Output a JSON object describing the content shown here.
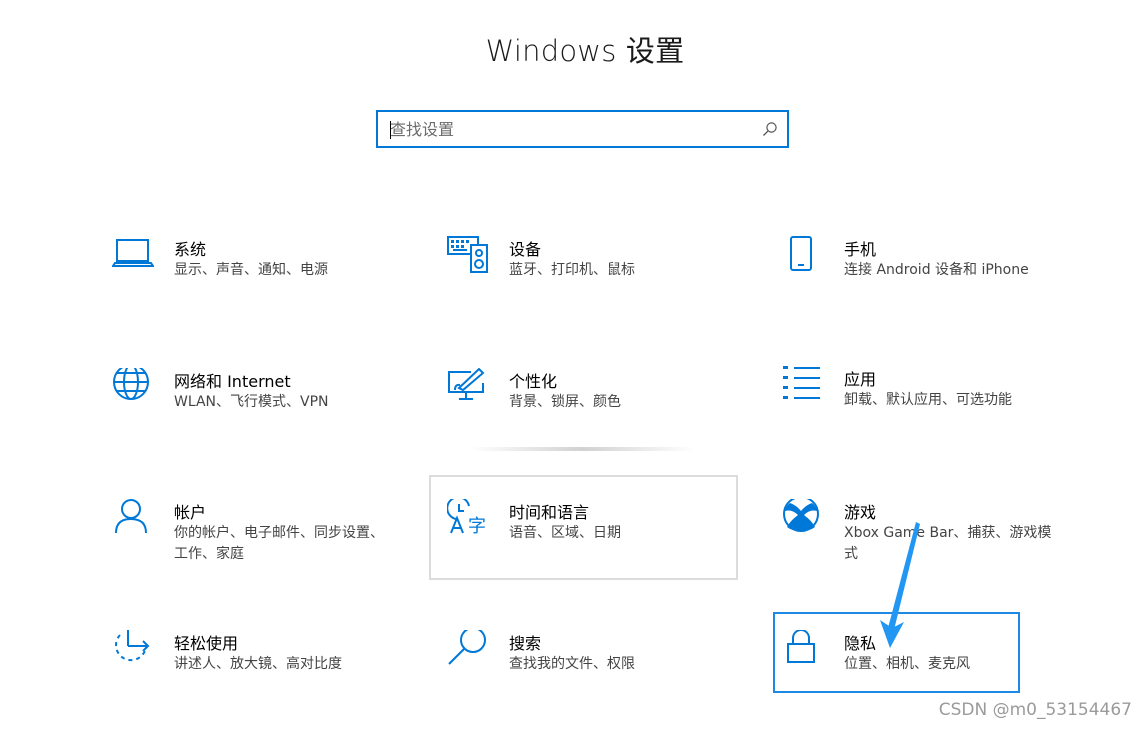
{
  "window": {
    "title": "Windows 设置"
  },
  "search": {
    "placeholder": "查找设置",
    "icon": "search-icon"
  },
  "colors": {
    "accent": "#0078d7",
    "focus_border": "#1e88e5",
    "arrow": "#2196f3"
  },
  "tiles": [
    {
      "id": "system",
      "name": "系统",
      "desc": "显示、声音、通知、电源",
      "icon": "laptop-icon"
    },
    {
      "id": "devices",
      "name": "设备",
      "desc": "蓝牙、打印机、鼠标",
      "icon": "keyboard-speaker-icon"
    },
    {
      "id": "phone",
      "name": "手机",
      "desc": "连接 Android 设备和 iPhone",
      "icon": "phone-icon"
    },
    {
      "id": "network",
      "name": "网络和 Internet",
      "desc": "WLAN、飞行模式、VPN",
      "icon": "globe-icon"
    },
    {
      "id": "personalization",
      "name": "个性化",
      "desc": "背景、锁屏、颜色",
      "icon": "paint-monitor-icon"
    },
    {
      "id": "apps",
      "name": "应用",
      "desc": "卸载、默认应用、可选功能",
      "icon": "app-list-icon"
    },
    {
      "id": "accounts",
      "name": "帐户",
      "desc": "你的帐户、电子邮件、同步设置、工作、家庭",
      "icon": "person-icon"
    },
    {
      "id": "time-language",
      "name": "时间和语言",
      "desc": "语音、区域、日期",
      "icon": "clock-language-icon"
    },
    {
      "id": "gaming",
      "name": "游戏",
      "desc": "Xbox Game Bar、捕获、游戏模式",
      "icon": "xbox-icon"
    },
    {
      "id": "ease-of-access",
      "name": "轻松使用",
      "desc": "讲述人、放大镜、高对比度",
      "icon": "ease-of-access-icon"
    },
    {
      "id": "search",
      "name": "搜索",
      "desc": "查找我的文件、权限",
      "icon": "magnifier-icon"
    },
    {
      "id": "privacy",
      "name": "隐私",
      "desc": "位置、相机、麦克风",
      "icon": "lock-icon"
    }
  ],
  "watermark": "CSDN @m0_53154467"
}
